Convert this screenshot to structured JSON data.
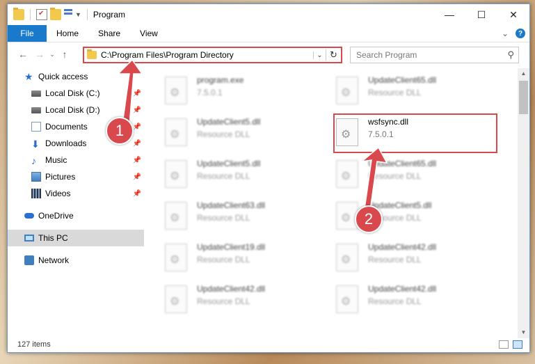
{
  "window": {
    "title": "Program"
  },
  "ribbon": {
    "file": "File",
    "tabs": [
      "Home",
      "Share",
      "View"
    ]
  },
  "address": {
    "path": "C:\\Program Files\\Program Directory",
    "search_placeholder": "Search Program"
  },
  "sidebar": {
    "quick_access": "Quick access",
    "items": [
      {
        "label": "Local Disk (C:)",
        "icon": "disk-icon",
        "pinned": true
      },
      {
        "label": "Local Disk (D:)",
        "icon": "disk-icon",
        "pinned": true
      },
      {
        "label": "Documents",
        "icon": "documents-icon",
        "pinned": true
      },
      {
        "label": "Downloads",
        "icon": "downloads-icon",
        "pinned": true
      },
      {
        "label": "Music",
        "icon": "music-icon",
        "pinned": true
      },
      {
        "label": "Pictures",
        "icon": "pictures-icon",
        "pinned": true
      },
      {
        "label": "Videos",
        "icon": "videos-icon",
        "pinned": true
      }
    ],
    "onedrive": "OneDrive",
    "this_pc": "This PC",
    "network": "Network"
  },
  "files": [
    {
      "name": "program.exe",
      "sub": "7.5.0.1"
    },
    {
      "name": "UpdateClient65.dll",
      "sub": "Resource DLL"
    },
    {
      "name": "UpdateClient5.dll",
      "sub": "Resource DLL"
    },
    {
      "name": "wsfsync.dll",
      "sub": "7.5.0.1"
    },
    {
      "name": "UpdateClient5.dll",
      "sub": "Resource DLL"
    },
    {
      "name": "UpdateClient65.dll",
      "sub": "Resource DLL"
    },
    {
      "name": "UpdateClient63.dll",
      "sub": "Resource DLL"
    },
    {
      "name": "UpdateClient5.dll",
      "sub": "Resource DLL"
    },
    {
      "name": "UpdateClient19.dll",
      "sub": "Resource DLL"
    },
    {
      "name": "UpdateClient42.dll",
      "sub": "Resource DLL"
    },
    {
      "name": "UpdateClient42.dll",
      "sub": "Resource DLL"
    },
    {
      "name": "UpdateClient42.dll",
      "sub": "Resource DLL"
    }
  ],
  "status": {
    "count": "127 items"
  },
  "markers": {
    "one": "1",
    "two": "2"
  },
  "colors": {
    "accent": "#1979ca",
    "highlight": "#d9484c"
  }
}
